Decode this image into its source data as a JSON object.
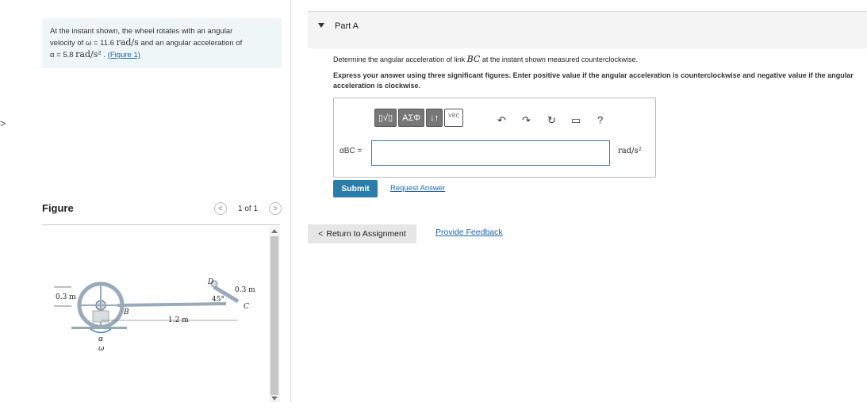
{
  "nav": {
    "expand_glyph": ">"
  },
  "problem": {
    "line1": "At the instant shown, the wheel rotates with an angular",
    "line2_prefix": "velocity of ω = 11.6",
    "omega_unit": "rad/s",
    "line2_suffix": "and an angular acceleration of",
    "alpha_prefix": "α = 5.8",
    "alpha_unit": "rad/s²",
    "figure_link": "(Figure 1)"
  },
  "figure_panel": {
    "title": "Figure",
    "page_indicator": "1 of 1",
    "prev_glyph": "<",
    "next_glyph": ">",
    "diagram_labels": {
      "left_dim": "0.3 m",
      "point_b": "B",
      "point_d": "D",
      "point_c": "C",
      "angle": "45°",
      "link_len": "0.3 m",
      "bottom_dim": "1.2 m",
      "alpha": "α",
      "omega": "ω"
    }
  },
  "part": {
    "title": "Part A",
    "question": "Determine the angular acceleration of link BC at the instant shown measured counterclockwise.",
    "question_pre": "Determine the angular acceleration of link",
    "question_var": "BC",
    "question_post": "at the instant shown measured counterclockwise.",
    "instructions": "Express your answer using three significant figures. Enter positive value if the angular acceleration is counterclockwise and negative value if the angular acceleration is clockwise."
  },
  "toolbar": {
    "templates": "▯√▯",
    "greek": "ΑΣΦ",
    "arrows": "↓↑",
    "vec": "vec",
    "undo": "↶",
    "redo": "↷",
    "reset": "↻",
    "keyboard": "▭",
    "help": "?"
  },
  "answer": {
    "label": "αBC =",
    "value": "",
    "unit": "rad/s²"
  },
  "actions": {
    "submit": "Submit",
    "request_answer": "Request Answer",
    "return_label": "Return to Assignment",
    "return_glyph": "<",
    "provide_feedback": "Provide Feedback"
  },
  "colors": {
    "accent": "#2a7cab",
    "link": "#1a66b0",
    "problem_bg": "#eef6f8",
    "input_border": "#3a7ca5"
  }
}
